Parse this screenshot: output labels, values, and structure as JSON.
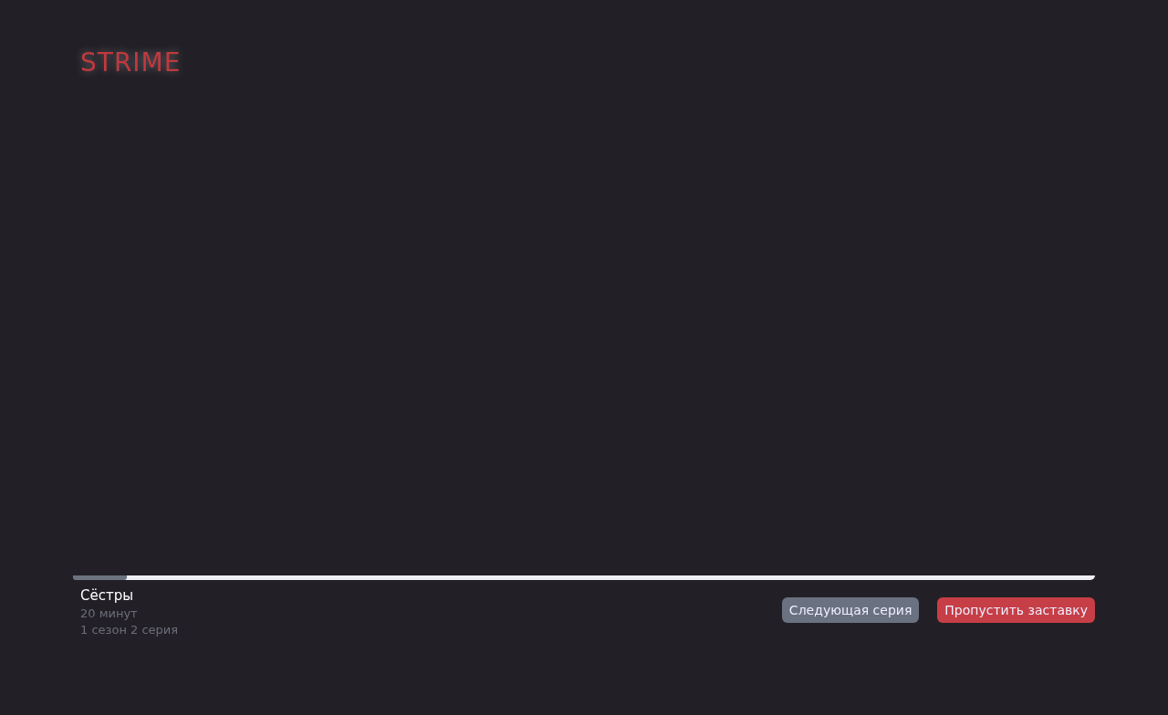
{
  "logo": "STRIME",
  "progress": {
    "level": 0.053
  },
  "episode": {
    "title": "Сёстры",
    "duration": "20 минут",
    "number": "1 сезон 2 серия"
  },
  "buttons": [
    {
      "label": "Следующая серия",
      "kind": "secondary"
    },
    {
      "label": "Пропустить заставку",
      "kind": "primary"
    }
  ]
}
